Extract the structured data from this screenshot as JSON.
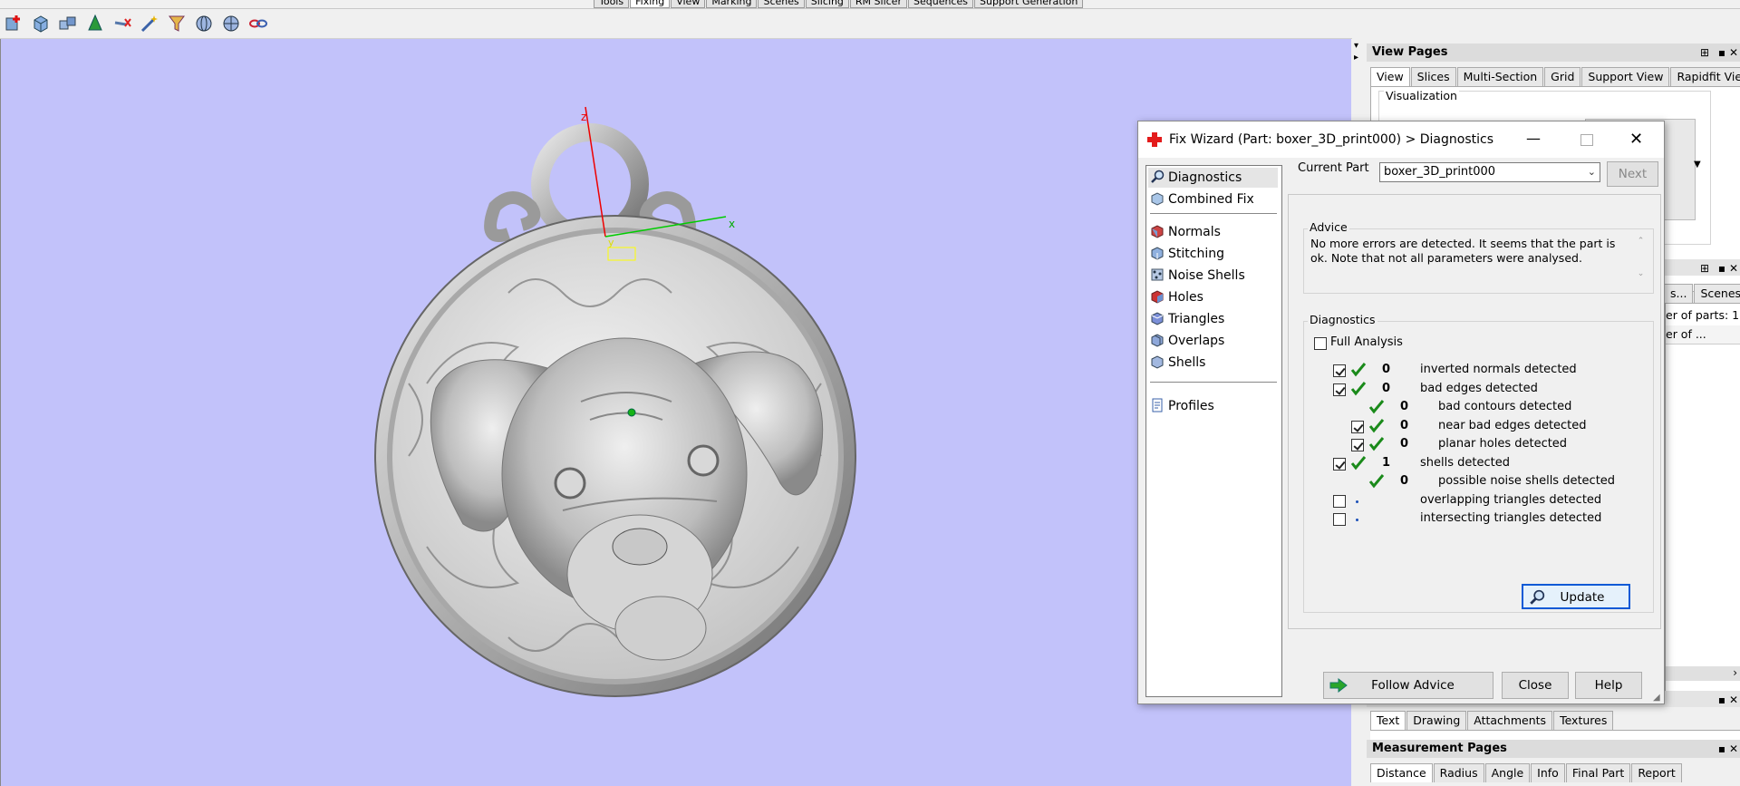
{
  "menu_tabs": [
    "Tools",
    "Fixing",
    "View",
    "Marking",
    "Scenes",
    "Slicing",
    "RM Slicer",
    "Sequences",
    "Support Generation"
  ],
  "active_menu_tab": "Fixing",
  "toolbar_icons": [
    "add-part-icon",
    "cube-icon",
    "cubes-icon",
    "cone-icon",
    "remove-icon",
    "wand-icon",
    "funnel-icon",
    "sphere-icon",
    "sphere-icon",
    "link-icon"
  ],
  "viewport": {
    "background": "#c2c2fa",
    "axis_z": "z",
    "axis_x": "x",
    "axis_y": "y"
  },
  "view_pages": {
    "title": "View Pages",
    "tabs": [
      "View",
      "Slices",
      "Multi-Section",
      "Grid",
      "Support View",
      "Rapidfit View"
    ],
    "active_tab": "View",
    "visualization_label": "Visualization"
  },
  "parts_panel": {
    "tab_label": "Scenes",
    "partial_tab": "s...",
    "number_of_parts": "er of parts: 1",
    "column_partial": "er of ..."
  },
  "lower_panel": {
    "tabs": [
      "Text",
      "Drawing",
      "Attachments",
      "Textures"
    ],
    "active_tab": "Text"
  },
  "measurement_pages": {
    "title": "Measurement Pages",
    "tabs": [
      "Distance",
      "Radius",
      "Angle",
      "Info",
      "Final Part",
      "Report"
    ],
    "active_tab": "Distance"
  },
  "dialog": {
    "title": "Fix Wizard (Part: boxer_3D_print000) > Diagnostics",
    "nav_items": [
      {
        "label": "Diagnostics",
        "icon": "magnifier-icon"
      },
      {
        "label": "Combined Fix",
        "icon": "cube-icon"
      },
      {
        "label": "Normals",
        "icon": "normals-cube-icon"
      },
      {
        "label": "Stitching",
        "icon": "stitching-cube-icon"
      },
      {
        "label": "Noise Shells",
        "icon": "noise-shells-icon"
      },
      {
        "label": "Holes",
        "icon": "holes-cube-icon"
      },
      {
        "label": "Triangles",
        "icon": "triangles-cube-icon"
      },
      {
        "label": "Overlaps",
        "icon": "overlaps-cube-icon"
      },
      {
        "label": "Shells",
        "icon": "shells-cube-icon"
      },
      {
        "label": "Profiles",
        "icon": "profiles-page-icon"
      }
    ],
    "current_part_label": "Current Part",
    "current_part_value": "boxer_3D_print000",
    "next_button": "Next",
    "advice_label": "Advice",
    "advice_text": "No more errors are detected. It seems that the part is ok. Note that not all parameters were analysed.",
    "diagnostics_label": "Diagnostics",
    "full_analysis_label": "Full Analysis",
    "full_analysis_checked": false,
    "rows": [
      {
        "checkbox": true,
        "checked": true,
        "status": "ok",
        "count": "0",
        "label": "inverted normals detected",
        "indent": 0
      },
      {
        "checkbox": true,
        "checked": true,
        "status": "ok",
        "count": "0",
        "label": "bad edges detected",
        "indent": 0
      },
      {
        "checkbox": false,
        "checked": false,
        "status": "ok",
        "count": "0",
        "label": "bad contours detected",
        "indent": 1
      },
      {
        "checkbox": true,
        "checked": true,
        "status": "ok",
        "count": "0",
        "label": "near bad edges detected",
        "indent": 1
      },
      {
        "checkbox": true,
        "checked": true,
        "status": "ok",
        "count": "0",
        "label": "planar holes detected",
        "indent": 1
      },
      {
        "checkbox": true,
        "checked": true,
        "status": "ok",
        "count": "1",
        "label": "shells detected",
        "indent": 0
      },
      {
        "checkbox": false,
        "checked": false,
        "status": "ok",
        "count": "0",
        "label": "possible noise shells detected",
        "indent": 1
      },
      {
        "checkbox": true,
        "checked": false,
        "status": "pending",
        "count": "",
        "label": "overlapping triangles detected",
        "indent": 0
      },
      {
        "checkbox": true,
        "checked": false,
        "status": "pending",
        "count": "",
        "label": "intersecting triangles detected",
        "indent": 0
      }
    ],
    "update_button": "Update",
    "follow_advice_button": "Follow Advice",
    "close_button": "Close",
    "help_button": "Help"
  }
}
